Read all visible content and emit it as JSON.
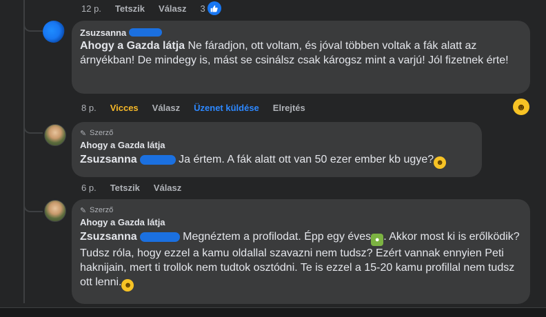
{
  "top_actions": {
    "time": "12 p.",
    "like": "Tetszik",
    "reply": "Válasz",
    "reaction_count": "3"
  },
  "comment1": {
    "author": "Zsuzsanna",
    "mention": "Ahogy a Gazda látja",
    "text": " Ne fáradjon, ott voltam, és jóval többen voltak a fák alatt az árnyékban! De mindegy is, mást se csinálsz csak károgsz mint a varjú! Jól fizetnek érte!",
    "actions": {
      "time": "8 p.",
      "reaction": "Vicces",
      "reply": "Válasz",
      "message": "Üzenet küldése",
      "hide": "Elrejtés"
    },
    "reaction_color": "#f7b928",
    "message_color": "#2d88ff"
  },
  "comment2": {
    "badge": "Szerző",
    "author": "Ahogy a Gazda látja",
    "mention": "Zsuzsanna",
    "text": " Ja értem. A fák alatt ott van 50 ezer ember kb ugye?",
    "actions": {
      "time": "6 p.",
      "like": "Tetszik",
      "reply": "Válasz"
    }
  },
  "comment3": {
    "badge": "Szerző",
    "author": "Ahogy a Gazda látja",
    "mention": "Zsuzsanna",
    "text_part1": " Megnéztem a profilodat. Épp egy éves",
    "text_part2": ". Akkor most ki is erőlködik? Tudsz róla, hogy ezzel a kamu oldallal szavazni nem tudsz? Ezért vannak ennyien Peti haknijain, mert ti trollok nem tudtok osztódni. Te is ezzel a 15-20 kamu profillal nem tudsz ott lenni."
  },
  "icons": {
    "like": "thumbs-up-icon",
    "mic": "microphone-icon",
    "emoji": "emoji-icon",
    "laugh": "laughing-emoji-icon",
    "baby": "baby-emoji-icon"
  }
}
